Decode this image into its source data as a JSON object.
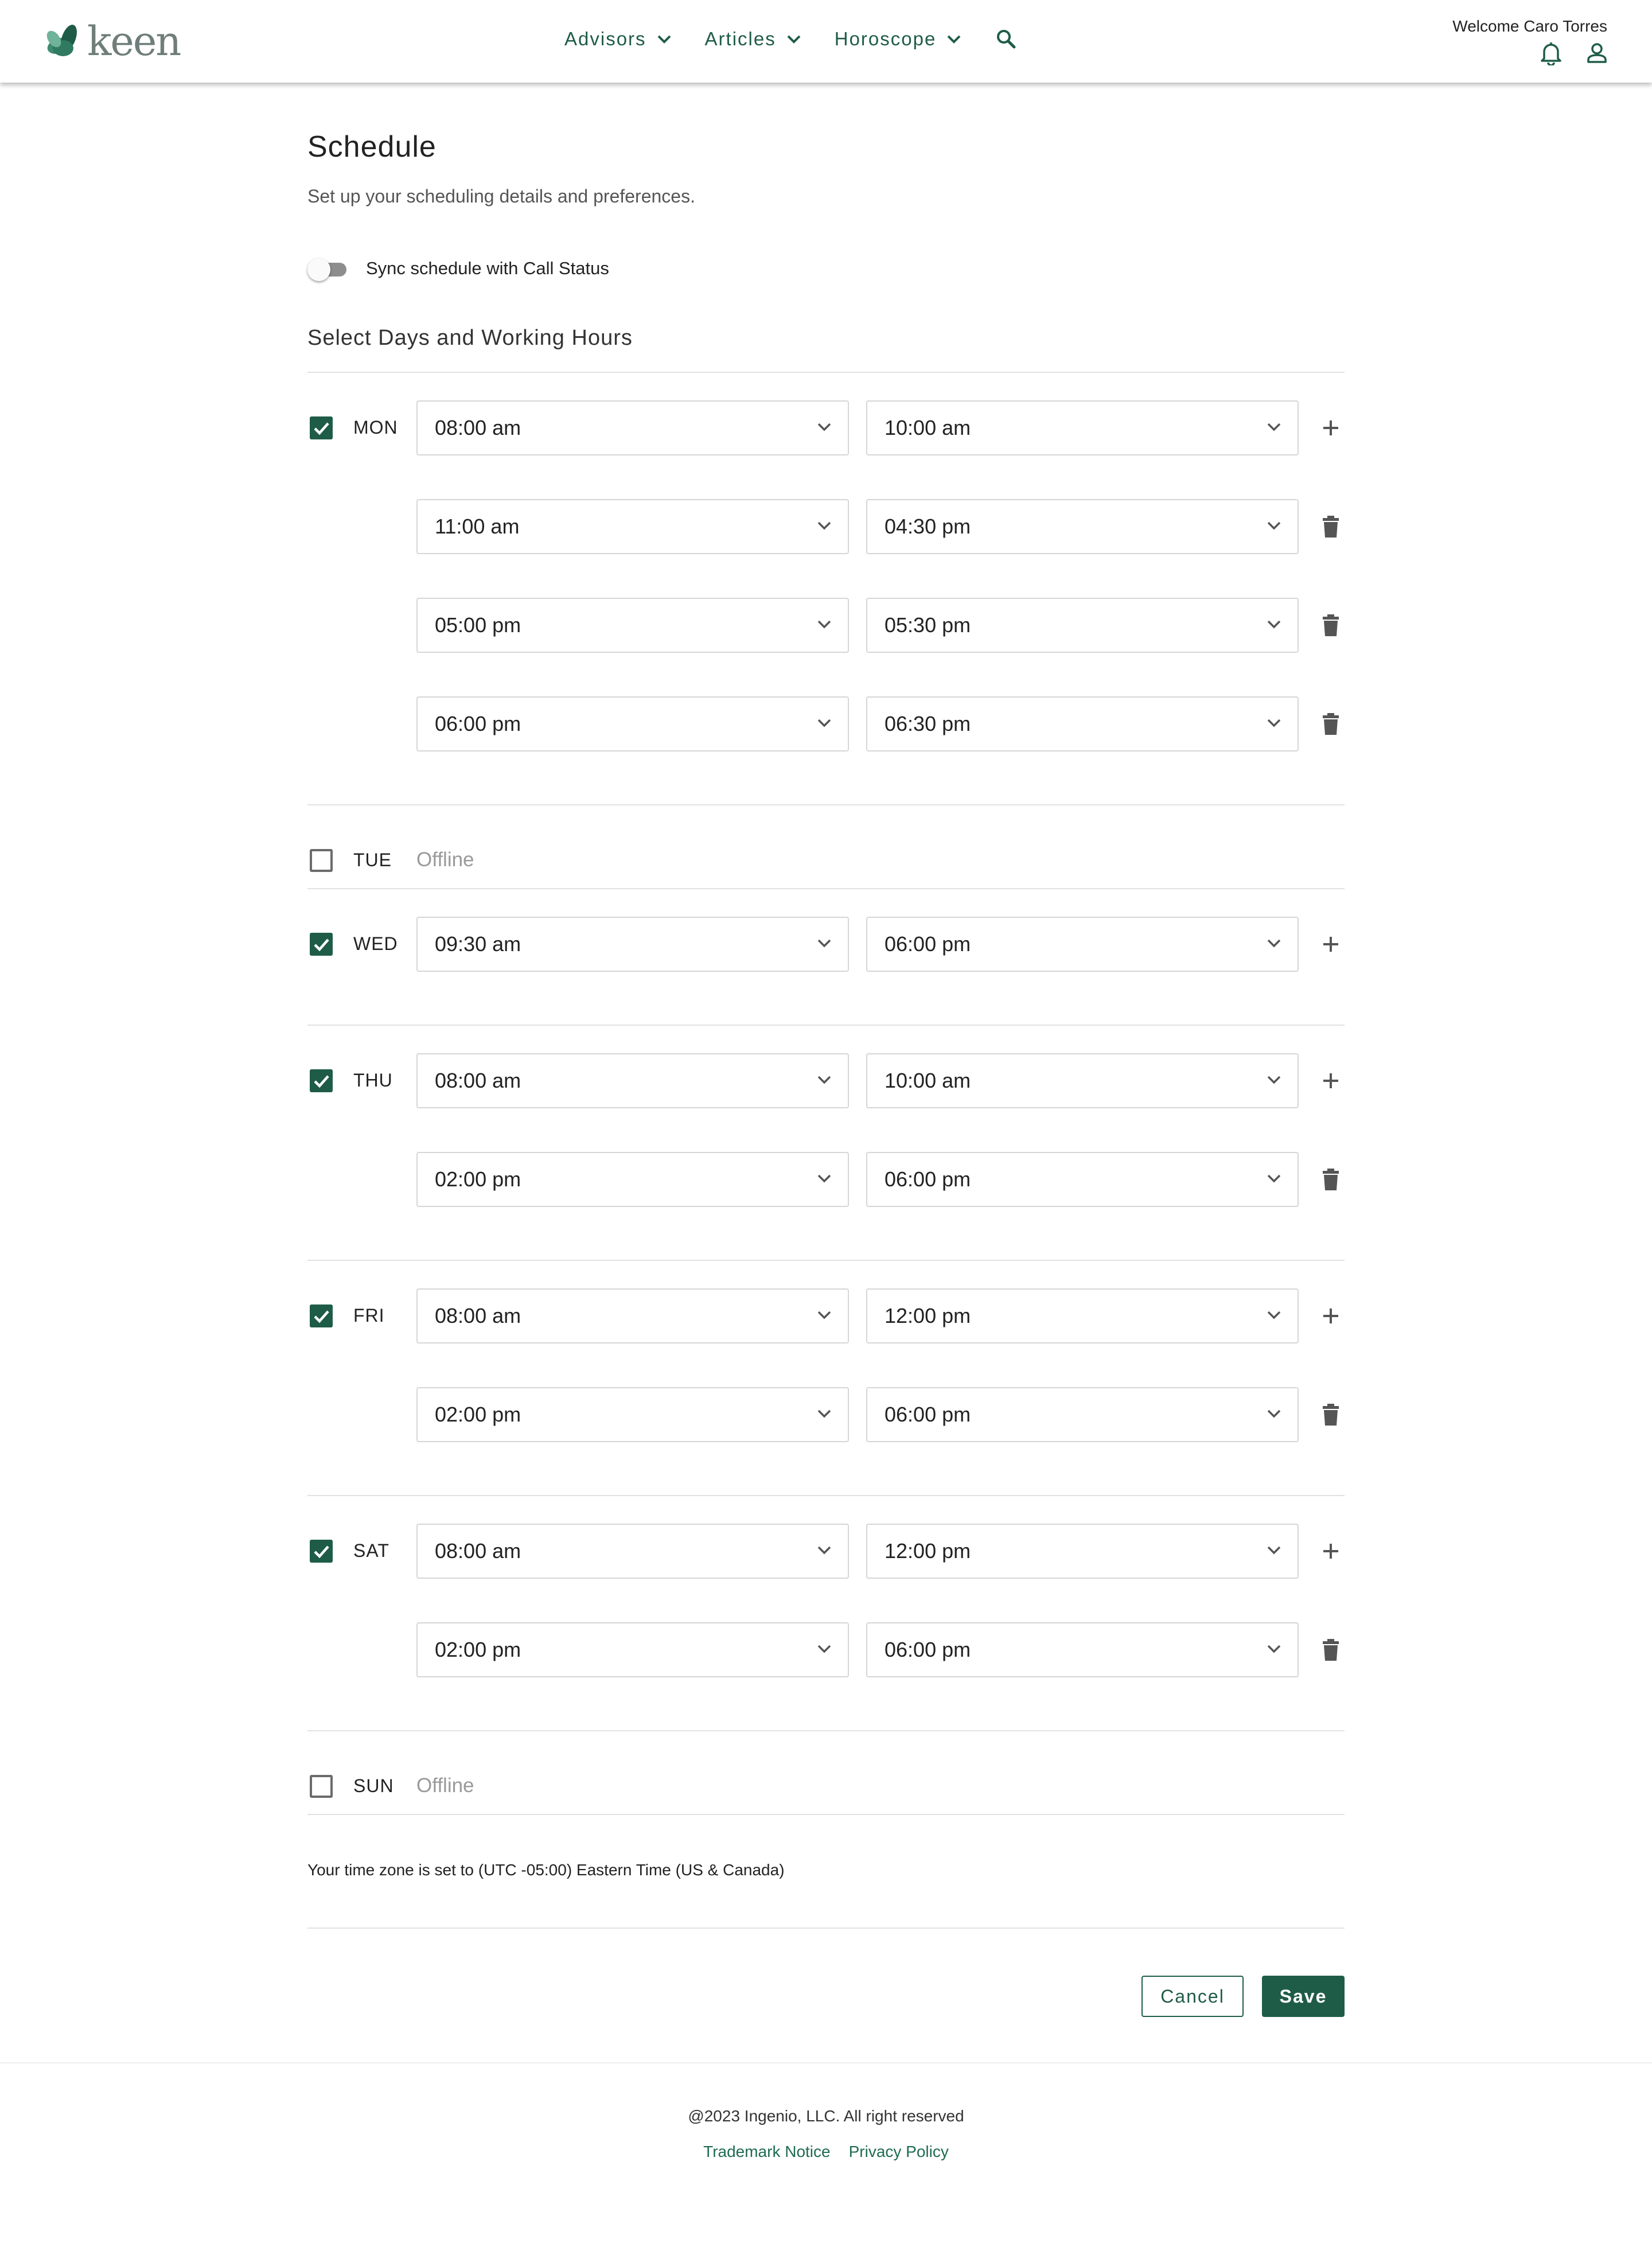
{
  "header": {
    "logo_text": "keen",
    "nav": [
      {
        "label": "Advisors"
      },
      {
        "label": "Articles"
      },
      {
        "label": "Horoscope"
      }
    ],
    "welcome_text": "Welcome Caro Torres",
    "icons": [
      "search-icon",
      "bell-icon",
      "user-icon"
    ]
  },
  "page": {
    "title": "Schedule",
    "subtitle": "Set up your scheduling details and preferences.",
    "sync_label": "Sync schedule with Call Status",
    "sync_enabled": false,
    "section_title": "Select Days and Working Hours"
  },
  "days": [
    {
      "day": "MON",
      "checked": true,
      "offline_label": "",
      "slots": [
        {
          "start": "08:00 am",
          "end": "10:00 am"
        },
        {
          "start": "11:00 am",
          "end": "04:30 pm"
        },
        {
          "start": "05:00 pm",
          "end": "05:30 pm"
        },
        {
          "start": "06:00 pm",
          "end": "06:30 pm"
        }
      ]
    },
    {
      "day": "TUE",
      "checked": false,
      "offline_label": "Offline",
      "slots": []
    },
    {
      "day": "WED",
      "checked": true,
      "offline_label": "",
      "slots": [
        {
          "start": "09:30 am",
          "end": "06:00 pm"
        }
      ]
    },
    {
      "day": "THU",
      "checked": true,
      "offline_label": "",
      "slots": [
        {
          "start": "08:00 am",
          "end": "10:00 am"
        },
        {
          "start": "02:00 pm",
          "end": "06:00 pm"
        }
      ]
    },
    {
      "day": "FRI",
      "checked": true,
      "offline_label": "",
      "slots": [
        {
          "start": "08:00 am",
          "end": "12:00 pm"
        },
        {
          "start": "02:00 pm",
          "end": "06:00 pm"
        }
      ]
    },
    {
      "day": "SAT",
      "checked": true,
      "offline_label": "",
      "slots": [
        {
          "start": "08:00 am",
          "end": "12:00 pm"
        },
        {
          "start": "02:00 pm",
          "end": "06:00 pm"
        }
      ]
    },
    {
      "day": "SUN",
      "checked": false,
      "offline_label": "Offline",
      "slots": []
    }
  ],
  "timezone_text": "Your time zone is set to (UTC -05:00) Eastern Time (US & Canada)",
  "actions": {
    "cancel_label": "Cancel",
    "save_label": "Save"
  },
  "footer": {
    "copyright": "@2023 Ingenio, LLC. All right reserved",
    "links": [
      {
        "label": "Trademark Notice"
      },
      {
        "label": "Privacy Policy"
      }
    ]
  },
  "colors": {
    "brand": "#1f5c48",
    "offline_text": "#9a9a9a",
    "divider": "#e2e2e2"
  }
}
